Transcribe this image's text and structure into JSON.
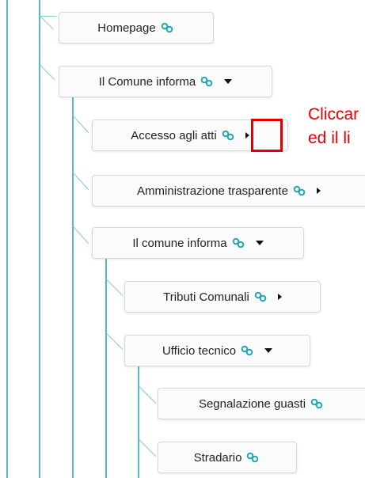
{
  "tree": {
    "homepage": "Homepage",
    "comune_informa_top": "Il Comune informa",
    "accesso_atti": "Accesso agli atti",
    "amministrazione": "Amministrazione trasparente",
    "comune_informa_sub": "Il comune informa",
    "tributi": "Tributi Comunali",
    "ufficio_tecnico": "Ufficio tecnico",
    "segnalazione": "Segnalazione guasti",
    "stradario": "Stradario"
  },
  "annotation": {
    "line1": "Cliccar",
    "line2": "ed il li"
  },
  "colors": {
    "tree_line": "#57b9c6",
    "link_icon": "#1fa6b8",
    "highlight": "#e00000"
  },
  "icons": {
    "link": "link-icon",
    "expanded": "caret-down-icon",
    "collapsed": "caret-right-icon"
  }
}
